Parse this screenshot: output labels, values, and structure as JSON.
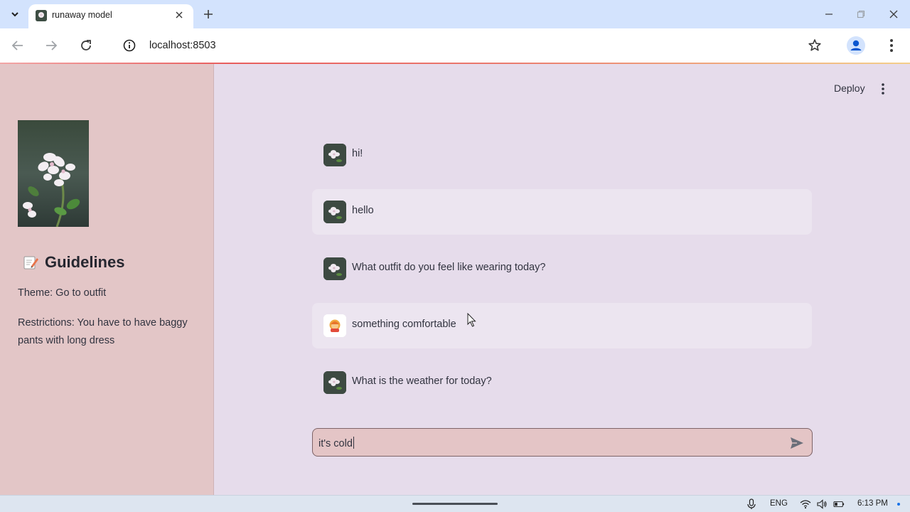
{
  "browser": {
    "tab_title": "runaway model",
    "url": "localhost:8503",
    "icons": [
      "tab-search-icon",
      "close-icon",
      "plus-icon",
      "minimize-icon",
      "restore-icon",
      "back-icon",
      "forward-icon",
      "reload-icon",
      "info-icon",
      "star-icon",
      "profile-icon",
      "kebab-menu-icon"
    ]
  },
  "app": {
    "deploy_label": "Deploy"
  },
  "sidebar": {
    "heading": "Guidelines",
    "heading_icon": "memo-emoji",
    "theme": "Theme: Go to outfit",
    "restrictions_line1": "Restrictions: You have to have baggy",
    "restrictions_line2": "pants with long dress"
  },
  "chat": {
    "messages": [
      {
        "role": "assistant",
        "text": "hi!",
        "shaded": false
      },
      {
        "role": "assistant",
        "text": "hello",
        "shaded": true
      },
      {
        "role": "assistant",
        "text": "What outfit do you feel like wearing today?",
        "shaded": false
      },
      {
        "role": "user",
        "text": "something comfortable",
        "shaded": true
      },
      {
        "role": "assistant",
        "text": "What is the weather for today?",
        "shaded": false
      }
    ],
    "input_value": "it's cold"
  },
  "taskbar": {
    "language": "ENG",
    "time": "6:13 PM"
  },
  "colors": {
    "sidebar_bg": "#e3c6c7",
    "main_bg": "#e6dceb",
    "input_bg": "#e4c5c6",
    "tabbar_bg": "#d3e3fd"
  }
}
